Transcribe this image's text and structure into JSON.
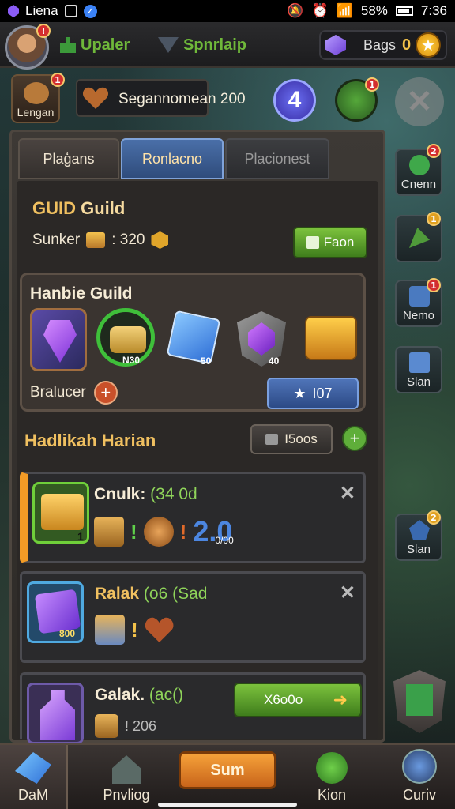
{
  "status_bar": {
    "app_name": "Liena",
    "battery": "58%",
    "time": "7:36"
  },
  "top_bar": {
    "avatar_badge": "!",
    "chip1_label": "Upaler",
    "chip2_label": "Spnrlaip",
    "currency_label": "Bags",
    "currency_value": "0"
  },
  "row2": {
    "left_button_label": "Lengan",
    "left_button_badge": "1",
    "heart_text": "Segannomean 200",
    "level_value": "4",
    "gem_badge": "1",
    "close_symbol": "✕"
  },
  "tabs": [
    {
      "label": "Plaģans"
    },
    {
      "label": "Ronlacno"
    },
    {
      "label": "Placionest"
    }
  ],
  "guild": {
    "title_prefix": "GUID",
    "title_word": "Guild",
    "sunker_label": "Sunker",
    "sunker_value": ": 320",
    "green_button": "Faon"
  },
  "reward_card": {
    "title": "Hanbie Guild",
    "green_reward_label": "N30",
    "blue_reward_label": "50",
    "shield_reward_label": "40",
    "bralucer_label": "Bralucer",
    "plus_symbol": "+",
    "blue_button": "I07",
    "blue_button_icon": "★"
  },
  "daily": {
    "title": "Hadlikah Harian",
    "button_label": "I5oos",
    "plus_symbol": "+"
  },
  "tasks": [
    {
      "title": "Cnulk:",
      "subtitle": "(34 0d",
      "icon_count": "1",
      "excl1": "!",
      "excl2": "!",
      "big_number": "2.0",
      "big_number_small": "0/00",
      "close": "✕"
    },
    {
      "title": "Ralak",
      "subtitle": "(o6 (Sad",
      "icon_count": "800",
      "excl1": "!",
      "close": "✕"
    },
    {
      "title": "Galak.",
      "subtitle": "(ac()",
      "count_text": "! 206",
      "button_label": "X6o0o",
      "button_arrow": "➜"
    }
  ],
  "side_buttons": [
    {
      "label": "Cnenn",
      "badge": "2"
    },
    {
      "label": "",
      "badge": "1"
    },
    {
      "label": "Nemo",
      "badge": "1"
    },
    {
      "label": "Slan"
    },
    {
      "label": "Slan",
      "badge": "2"
    }
  ],
  "bottom_nav": [
    {
      "label": "DaM"
    },
    {
      "label": "Pnvliog"
    },
    {
      "label": "Sum"
    },
    {
      "label": "Kion"
    },
    {
      "label": "Curiv"
    }
  ],
  "colors": {
    "accent_gold": "#f0c060",
    "accent_green": "#6fb83a",
    "accent_blue": "#4f74b8",
    "accent_orange": "#f29b26"
  }
}
